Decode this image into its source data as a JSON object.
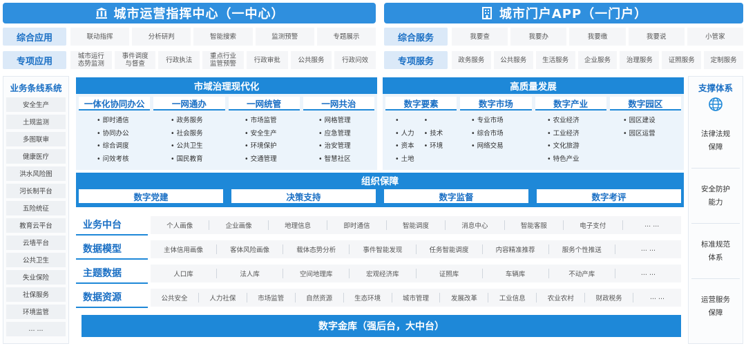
{
  "top_left": {
    "title": "城市运营指挥中心（一中心）",
    "rows": [
      {
        "label": "综合应用",
        "items": [
          "联动指挥",
          "分析研判",
          "智能搜索",
          "监测预警",
          "专题展示"
        ]
      },
      {
        "label": "专项应用",
        "items": [
          "城市运行\n态势监测",
          "事件调度\n与督查",
          "行政执法",
          "重点行业\n监管预警",
          "行政审批",
          "公共服务",
          "行政问效"
        ]
      }
    ]
  },
  "top_right": {
    "title": "城市门户APP（一门户）",
    "rows": [
      {
        "label": "综合服务",
        "items": [
          "我要查",
          "我要办",
          "我要缴",
          "我要说",
          "小管家"
        ]
      },
      {
        "label": "专项服务",
        "items": [
          "政务服务",
          "公共服务",
          "生活服务",
          "企业服务",
          "治理服务",
          "证照服务",
          "定制服务"
        ]
      }
    ]
  },
  "left_column": {
    "title": "业务条线系统",
    "items": [
      "安全生产",
      "土规监测",
      "多图联审",
      "健康医疗",
      "洪水风险图",
      "河长制平台",
      "五险统征",
      "教育云平台",
      "云墙平台",
      "公共卫生",
      "失业保险",
      "社保服务",
      "环境监管",
      "... ..."
    ]
  },
  "governance": {
    "title": "市域治理现代化",
    "groups": [
      {
        "name": "一体化协同办公",
        "items": [
          "即时通信",
          "协同办公",
          "综合调度",
          "问效考核"
        ]
      },
      {
        "name": "一网通办",
        "items": [
          "政务服务",
          "社会服务",
          "公共卫生",
          "国民教育"
        ]
      },
      {
        "name": "一网统管",
        "items": [
          "市场监管",
          "安全生产",
          "环境保护",
          "交通管理"
        ]
      },
      {
        "name": "一网共治",
        "items": [
          "网格管理",
          "应急管理",
          "治安管理",
          "智慧社区"
        ]
      }
    ]
  },
  "development": {
    "title": "高质量发展",
    "groups": [
      {
        "name": "数字要素",
        "items": [
          "人力",
          "资本",
          "土地"
        ],
        "items2": [
          "技术",
          "环境"
        ]
      },
      {
        "name": "数字市场",
        "items": [
          "专业市场",
          "综合市场",
          "网络交易"
        ]
      },
      {
        "name": "数字产业",
        "items": [
          "农业经济",
          "工业经济",
          "文化旅游",
          "特色产业"
        ]
      },
      {
        "name": "数字园区",
        "items": [
          "园区建设",
          "园区运营"
        ]
      }
    ]
  },
  "org": {
    "title": "组织保障",
    "items": [
      "数字党建",
      "决策支持",
      "数字监督",
      "数字考评"
    ]
  },
  "data_layers": [
    {
      "label": "业务中台",
      "items": [
        "个人画像",
        "企业画像",
        "地理信息",
        "即时通信",
        "智能调度",
        "消息中心",
        "智能客服",
        "电子支付",
        "... ..."
      ]
    },
    {
      "label": "数据模型",
      "items": [
        "主体信用画像",
        "客体风险画像",
        "载体态势分析",
        "事件智能发现",
        "任务智能调度",
        "内容精准推荐",
        "服务个性推送",
        "... ..."
      ]
    },
    {
      "label": "主题数据",
      "items": [
        "人口库",
        "法人库",
        "空间地理库",
        "宏观经济库",
        "证照库",
        "车辆库",
        "不动产库",
        "... ..."
      ]
    },
    {
      "label": "数据资源",
      "items": [
        "公共安全",
        "人力社保",
        "市场监管",
        "自然资源",
        "生态环境",
        "城市管理",
        "发展改革",
        "工业信息",
        "农业农村",
        "财政税务",
        "... ..."
      ]
    }
  ],
  "vault": {
    "title": "数字金库（强后台，大中台）"
  },
  "right_column": {
    "title": "支撑体系",
    "icon": "globe-icon",
    "items": [
      "法律法规保障",
      "安全防护能力",
      "标准规范体系",
      "运营服务保障"
    ]
  },
  "colors": {
    "primary": "#1e88d8",
    "banner": "#2f8fde",
    "label_bg": "#dbe9f8",
    "accent_text": "#1a6fc4"
  }
}
